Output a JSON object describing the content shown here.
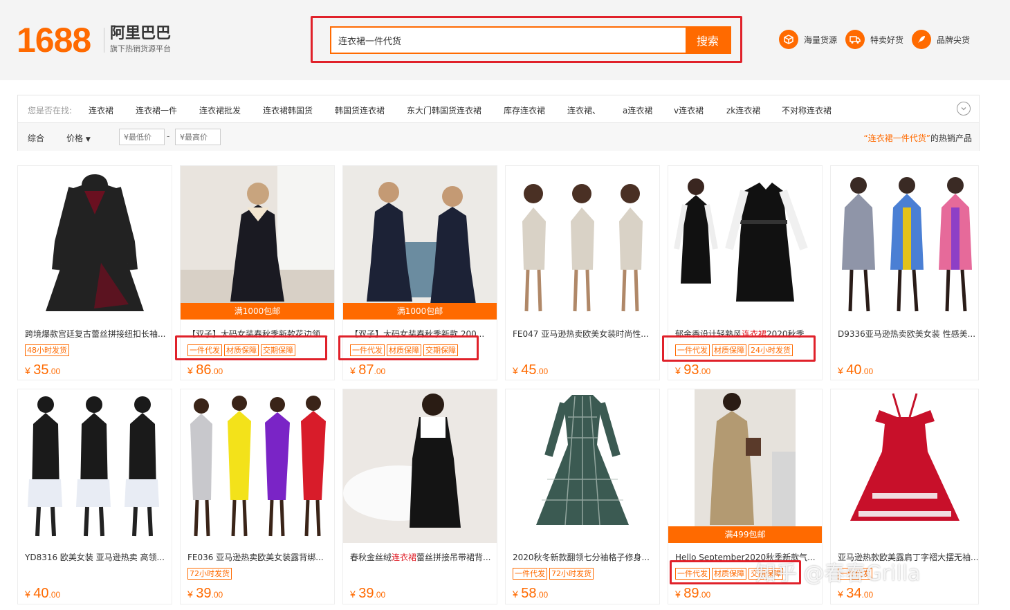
{
  "header": {
    "logo_number": "1688",
    "logo_brand": "阿里巴巴",
    "logo_sub": "旗下热销货源平台",
    "search_value": "连衣裙一件代货",
    "search_button": "搜索",
    "nav": [
      {
        "label": "海量货源",
        "icon": "box-icon"
      },
      {
        "label": "特卖好货",
        "icon": "truck-icon"
      },
      {
        "label": "品牌尖货",
        "icon": "rocket-icon"
      }
    ]
  },
  "filter": {
    "suggest_label": "您是否在找:",
    "suggestions": [
      "连衣裙",
      "连衣裙一件",
      "连衣裙批发",
      "连衣裙韩国货",
      "韩国货连衣裙",
      "东大门韩国货连衣裙",
      "库存连衣裙",
      "连衣裙、",
      "a连衣裙",
      "v连衣裙",
      "zk连衣裙",
      "不对称连衣裙"
    ],
    "sort_all": "综合",
    "sort_price": "价格",
    "price_min_placeholder": "¥最低价",
    "price_max_placeholder": "¥最高价",
    "price_dash": "-",
    "hot_keyword": "“连衣裙一件代货”",
    "hot_suffix": "的热销产品"
  },
  "products": [
    {
      "title": "跨境爆款宫廷复古蕾丝拼接纽扣长袖...",
      "tags": [
        "48小时发货"
      ],
      "price_int": "35",
      "price_dec": ".00",
      "banner": ""
    },
    {
      "title": "【双子】大码女装春秋季新款花边领...",
      "tags": [
        "一件代发",
        "材质保障",
        "交期保障"
      ],
      "price_int": "86",
      "price_dec": ".00",
      "banner": "满1000包邮"
    },
    {
      "title": "【双子】大码女装春秋季新款 200...",
      "tags": [
        "一件代发",
        "材质保障",
        "交期保障"
      ],
      "price_int": "87",
      "price_dec": ".00",
      "banner": "满1000包邮"
    },
    {
      "title": "FE047 亚马逊热卖欧美女装时尚性...",
      "tags": [],
      "price_int": "45",
      "price_dec": ".00",
      "banner": ""
    },
    {
      "title_pre": "郁金香设计轻熟风",
      "title_hl": "连衣裙",
      "title_post": "2020秋季...",
      "tags": [
        "一件代发",
        "材质保障",
        "24小时发货"
      ],
      "price_int": "93",
      "price_dec": ".00",
      "banner": ""
    },
    {
      "title": "D9336亚马逊热卖欧美女装 性感美...",
      "tags": [],
      "price_int": "40",
      "price_dec": ".00",
      "banner": ""
    },
    {
      "title": "YD8316 欧美女装 亚马逊热卖 高领...",
      "tags": [],
      "price_int": "40",
      "price_dec": ".00",
      "banner": ""
    },
    {
      "title": "FE036 亚马逊热卖欧美女装露背绑...",
      "tags": [
        "72小时发货"
      ],
      "price_int": "39",
      "price_dec": ".00",
      "banner": ""
    },
    {
      "title_pre": "春秋金丝绒",
      "title_hl": "连衣裙",
      "title_post": "蕾丝拼接吊带裙背...",
      "tags": [],
      "price_int": "39",
      "price_dec": ".00",
      "banner": ""
    },
    {
      "title": "2020秋冬新款翻领七分袖格子修身...",
      "tags": [
        "一件代发",
        "72小时发货"
      ],
      "price_int": "58",
      "price_dec": ".00",
      "banner": ""
    },
    {
      "title": "Hello September2020秋季新款气...",
      "tags": [
        "一件代发",
        "材质保障",
        "交期保障"
      ],
      "price_int": "89",
      "price_dec": ".00",
      "banner": "满499包邮"
    },
    {
      "title": "亚马逊热款欧美露肩丁字褶大摆无袖...",
      "tags": [
        "一件代发"
      ],
      "price_int": "34",
      "price_dec": ".00",
      "banner": ""
    }
  ],
  "currency": "¥",
  "watermark": "知乎 @春春Grilla",
  "colors": {
    "accent": "#ff6a00",
    "highlight": "#e0212a"
  }
}
